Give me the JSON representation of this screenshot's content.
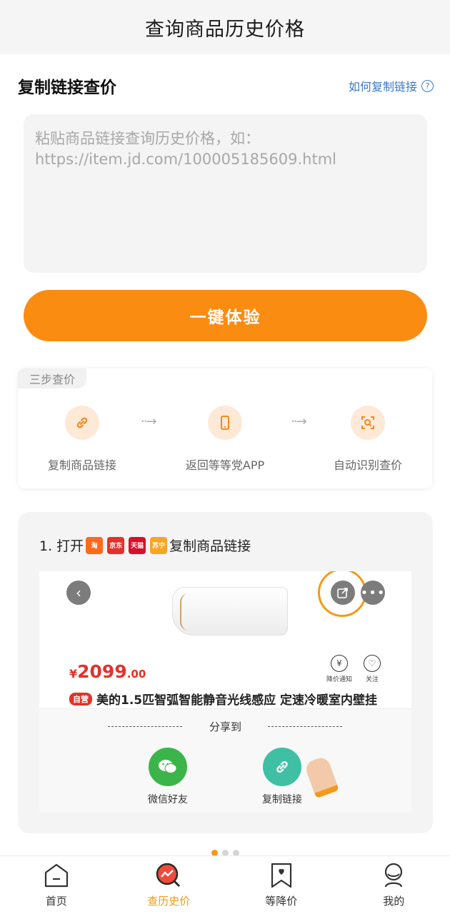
{
  "header": {
    "title": "查询商品历史价格"
  },
  "copy_section": {
    "title": "复制链接查价",
    "help_link": "如何复制链接"
  },
  "paste_box": {
    "placeholder": "粘贴商品链接查询历史价格，如：https://item.jd.com/100005185609.html",
    "value": ""
  },
  "cta": {
    "label": "一键体验"
  },
  "steps": {
    "tag": "三步查价",
    "items": [
      {
        "label": "复制商品链接",
        "icon": "link-icon"
      },
      {
        "label": "返回等等党APP",
        "icon": "phone-icon"
      },
      {
        "label": "自动识别查价",
        "icon": "scan-icon"
      }
    ],
    "arrow": "··→"
  },
  "guide": {
    "step_prefix": "1. 打开",
    "step_suffix": "复制商品链接",
    "app_badges": [
      {
        "name": "taobao",
        "text": "淘",
        "color": "#ff6a1c"
      },
      {
        "name": "jd",
        "text": "京东",
        "color": "#e4312b"
      },
      {
        "name": "tmall",
        "text": "天猫",
        "color": "#d90f2a"
      },
      {
        "name": "suning",
        "text": "苏宁",
        "color": "#f5a623"
      }
    ],
    "demo": {
      "price_symbol": "¥",
      "price_int": "2099",
      "price_dec": ".00",
      "price_notify": "降价通知",
      "follow": "关注",
      "self_tag": "自营",
      "product_title": "美的1.5匹智弧智能静音光线感应 定速冷暖室内壁挂",
      "share_to": "分享到",
      "share_options": [
        {
          "label": "微信好友",
          "icon": "wechat-icon",
          "color": "#3bb54a"
        },
        {
          "label": "复制链接",
          "icon": "link-icon",
          "color": "#3fbfa4"
        }
      ]
    }
  },
  "carousel": {
    "count": 3,
    "active": 0
  },
  "tabbar": {
    "items": [
      {
        "label": "首页",
        "icon": "home-icon"
      },
      {
        "label": "查历史价",
        "icon": "price-history-icon"
      },
      {
        "label": "等降价",
        "icon": "bookmark-icon"
      },
      {
        "label": "我的",
        "icon": "user-icon"
      }
    ],
    "active_index": 1
  },
  "colors": {
    "accent": "#fb8c12",
    "link": "#3a78c9",
    "price": "#e4312b"
  }
}
